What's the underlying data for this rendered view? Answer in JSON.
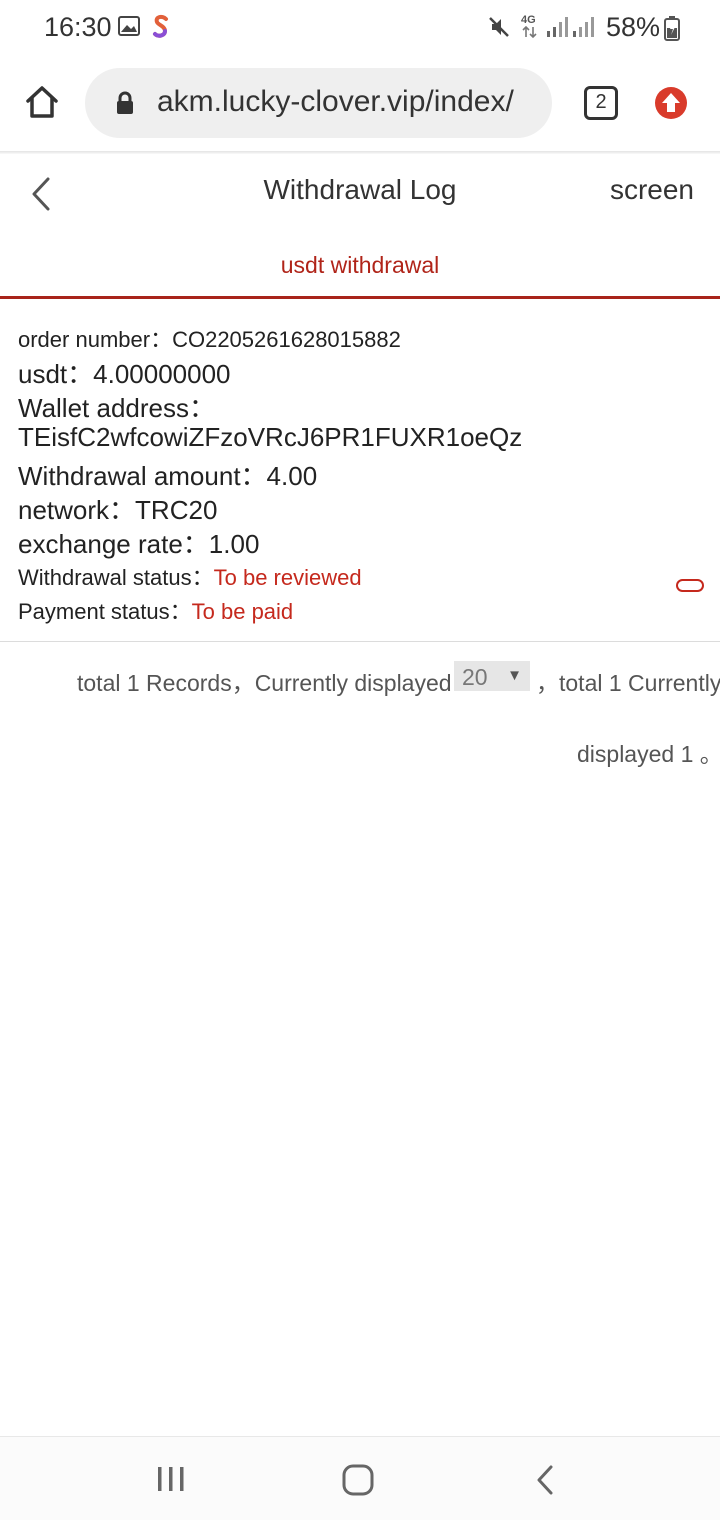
{
  "status_bar": {
    "time": "16:30",
    "battery": "58%",
    "icons": [
      "gallery-icon",
      "app-s-icon",
      "mute-icon",
      "network-4g-icon",
      "signal-icon",
      "signal-icon",
      "battery-icon"
    ]
  },
  "browser": {
    "url": "akm.lucky-clover.vip/index/",
    "tab_count": "2",
    "icons": [
      "home-icon",
      "lock-icon",
      "tabs-icon",
      "update-icon"
    ]
  },
  "header": {
    "back_icon": "chevron-left-icon",
    "title": "Withdrawal Log",
    "filter_label": "screen"
  },
  "tabs": [
    {
      "label": "usdt withdrawal",
      "active": true
    }
  ],
  "record": {
    "order_label": "order number：",
    "order_value": "CO2205261628015882",
    "usdt_label": "usdt：",
    "usdt_value": "4.00000000",
    "wallet_label": "Wallet address：",
    "wallet_value": "TEisfC2wfcowiZFzoVRcJ6PR1FUXR1oeQz",
    "amount_label": "Withdrawal amount：",
    "amount_value": "4.00",
    "network_label": "network：",
    "network_value": "TRC20",
    "rate_label": "exchange rate：",
    "rate_value": "1.00",
    "withdrawal_status_label": "Withdrawal status：",
    "withdrawal_status_value": "To be reviewed",
    "payment_status_label": "Payment status：",
    "payment_status_value": "To be paid"
  },
  "pagination": {
    "text_before": "total 1 Records，Currently displayed",
    "page_size": "20",
    "text_after": "，total 1 Currently",
    "text_wrap": "displayed 1 。"
  },
  "nav_bar": {
    "icons": [
      "recent-apps-icon",
      "home-button-icon",
      "back-icon"
    ]
  },
  "colors": {
    "accent": "#a8231a",
    "status_red": "#c5291d",
    "browser_update": "#d93b2b"
  }
}
